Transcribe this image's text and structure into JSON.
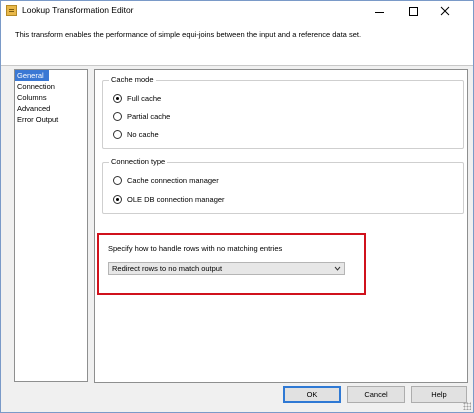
{
  "window": {
    "title": "Lookup Transformation Editor",
    "description": "This transform enables the performance of simple equi-joins between the input and a reference data set."
  },
  "nav": {
    "items": [
      {
        "label": "General",
        "selected": true
      },
      {
        "label": "Connection",
        "selected": false
      },
      {
        "label": "Columns",
        "selected": false
      },
      {
        "label": "Advanced",
        "selected": false
      },
      {
        "label": "Error Output",
        "selected": false
      }
    ]
  },
  "cache_mode": {
    "title": "Cache mode",
    "options": [
      {
        "label": "Full cache",
        "checked": true
      },
      {
        "label": "Partial cache",
        "checked": false
      },
      {
        "label": "No cache",
        "checked": false
      }
    ]
  },
  "connection_type": {
    "title": "Connection type",
    "options": [
      {
        "label": "Cache connection manager",
        "checked": false
      },
      {
        "label": "OLE DB connection manager",
        "checked": true
      }
    ]
  },
  "no_match": {
    "label": "Specify how to handle rows with no matching entries",
    "selected_value": "Redirect rows to no match output",
    "highlight_color": "#d0111c"
  },
  "buttons": {
    "ok": "OK",
    "cancel": "Cancel",
    "help": "Help"
  },
  "colors": {
    "selection": "#3a78d4",
    "default_button_border": "#2f79d4"
  }
}
